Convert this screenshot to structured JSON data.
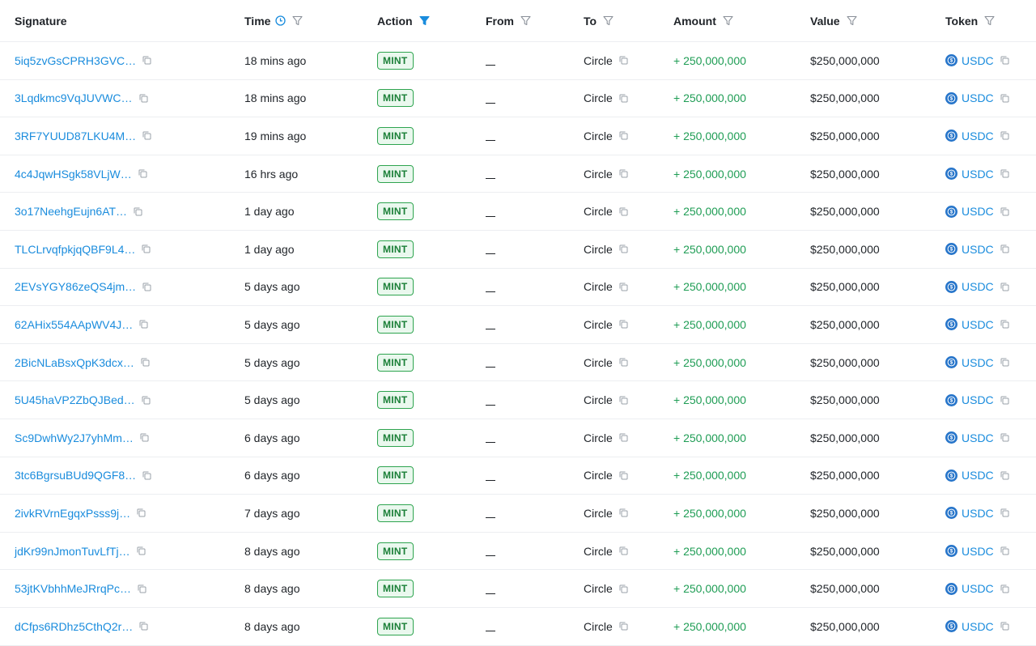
{
  "headers": {
    "signature": "Signature",
    "time": "Time",
    "action": "Action",
    "from": "From",
    "to": "To",
    "amount": "Amount",
    "value": "Value",
    "token": "Token"
  },
  "colors": {
    "link": "#1a8cdd",
    "amount_green": "#1f9d55",
    "badge_border": "#2ea44f",
    "active_filter": "#1a8cdd",
    "usdc_blue": "#2775ca"
  },
  "icons": {
    "header_filter": "filter-icon",
    "time_sort": "clock-icon",
    "copy": "copy-icon",
    "token": "usdc-icon"
  },
  "rows": [
    {
      "signature": "5iq5zvGsCPRH3GVC…",
      "time": "18 mins ago",
      "action": "MINT",
      "from": "",
      "to": "Circle",
      "amount": "+ 250,000,000",
      "value": "$250,000,000",
      "token": "USDC"
    },
    {
      "signature": "3Lqdkmc9VqJUVWC…",
      "time": "18 mins ago",
      "action": "MINT",
      "from": "",
      "to": "Circle",
      "amount": "+ 250,000,000",
      "value": "$250,000,000",
      "token": "USDC"
    },
    {
      "signature": "3RF7YUUD87LKU4M…",
      "time": "19 mins ago",
      "action": "MINT",
      "from": "",
      "to": "Circle",
      "amount": "+ 250,000,000",
      "value": "$250,000,000",
      "token": "USDC"
    },
    {
      "signature": "4c4JqwHSgk58VLjW…",
      "time": "16 hrs ago",
      "action": "MINT",
      "from": "",
      "to": "Circle",
      "amount": "+ 250,000,000",
      "value": "$250,000,000",
      "token": "USDC"
    },
    {
      "signature": "3o17NeehgEujn6AT…",
      "time": "1 day ago",
      "action": "MINT",
      "from": "",
      "to": "Circle",
      "amount": "+ 250,000,000",
      "value": "$250,000,000",
      "token": "USDC"
    },
    {
      "signature": "TLCLrvqfpkjqQBF9L4…",
      "time": "1 day ago",
      "action": "MINT",
      "from": "",
      "to": "Circle",
      "amount": "+ 250,000,000",
      "value": "$250,000,000",
      "token": "USDC"
    },
    {
      "signature": "2EVsYGY86zeQS4jm…",
      "time": "5 days ago",
      "action": "MINT",
      "from": "",
      "to": "Circle",
      "amount": "+ 250,000,000",
      "value": "$250,000,000",
      "token": "USDC"
    },
    {
      "signature": "62AHix554AApWV4J…",
      "time": "5 days ago",
      "action": "MINT",
      "from": "",
      "to": "Circle",
      "amount": "+ 250,000,000",
      "value": "$250,000,000",
      "token": "USDC"
    },
    {
      "signature": "2BicNLaBsxQpK3dcx…",
      "time": "5 days ago",
      "action": "MINT",
      "from": "",
      "to": "Circle",
      "amount": "+ 250,000,000",
      "value": "$250,000,000",
      "token": "USDC"
    },
    {
      "signature": "5U45haVP2ZbQJBed…",
      "time": "5 days ago",
      "action": "MINT",
      "from": "",
      "to": "Circle",
      "amount": "+ 250,000,000",
      "value": "$250,000,000",
      "token": "USDC"
    },
    {
      "signature": "Sc9DwhWy2J7yhMm…",
      "time": "6 days ago",
      "action": "MINT",
      "from": "",
      "to": "Circle",
      "amount": "+ 250,000,000",
      "value": "$250,000,000",
      "token": "USDC"
    },
    {
      "signature": "3tc6BgrsuBUd9QGF8…",
      "time": "6 days ago",
      "action": "MINT",
      "from": "",
      "to": "Circle",
      "amount": "+ 250,000,000",
      "value": "$250,000,000",
      "token": "USDC"
    },
    {
      "signature": "2ivkRVrnEgqxPsss9j…",
      "time": "7 days ago",
      "action": "MINT",
      "from": "",
      "to": "Circle",
      "amount": "+ 250,000,000",
      "value": "$250,000,000",
      "token": "USDC"
    },
    {
      "signature": "jdKr99nJmonTuvLfTj…",
      "time": "8 days ago",
      "action": "MINT",
      "from": "",
      "to": "Circle",
      "amount": "+ 250,000,000",
      "value": "$250,000,000",
      "token": "USDC"
    },
    {
      "signature": "53jtKVbhhMeJRrqPc…",
      "time": "8 days ago",
      "action": "MINT",
      "from": "",
      "to": "Circle",
      "amount": "+ 250,000,000",
      "value": "$250,000,000",
      "token": "USDC"
    },
    {
      "signature": "dCfps6RDhz5CthQ2r…",
      "time": "8 days ago",
      "action": "MINT",
      "from": "",
      "to": "Circle",
      "amount": "+ 250,000,000",
      "value": "$250,000,000",
      "token": "USDC"
    }
  ]
}
